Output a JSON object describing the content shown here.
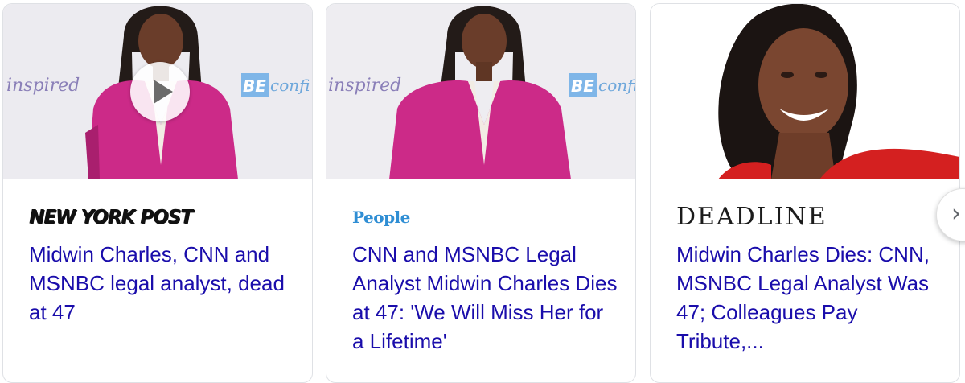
{
  "cards": [
    {
      "publisher": "NEW YORK POST",
      "headline": "Midwin Charles, CNN and MSNBC legal analyst, dead at 47",
      "has_video": true,
      "backdrop_texts": [
        "inspired",
        "BE",
        "confi"
      ]
    },
    {
      "publisher": "People",
      "headline": "CNN and MSNBC Legal Analyst Midwin Charles Dies at 47: 'We Will Miss Her for a Lifetime'",
      "has_video": false,
      "backdrop_texts": [
        "inspired",
        "BE",
        "confi"
      ]
    },
    {
      "publisher": "DEADLINE",
      "headline": "Midwin Charles Dies: CNN, MSNBC Legal Analyst Was 47; Colleagues Pay Tribute,...",
      "has_video": false
    }
  ],
  "next_button": {
    "icon": "chevron-right-icon"
  },
  "colors": {
    "headline_link": "#1a0dab",
    "people_brand": "#2f8ed4",
    "blazer": "#cc2a88",
    "red_top": "#d42020"
  }
}
